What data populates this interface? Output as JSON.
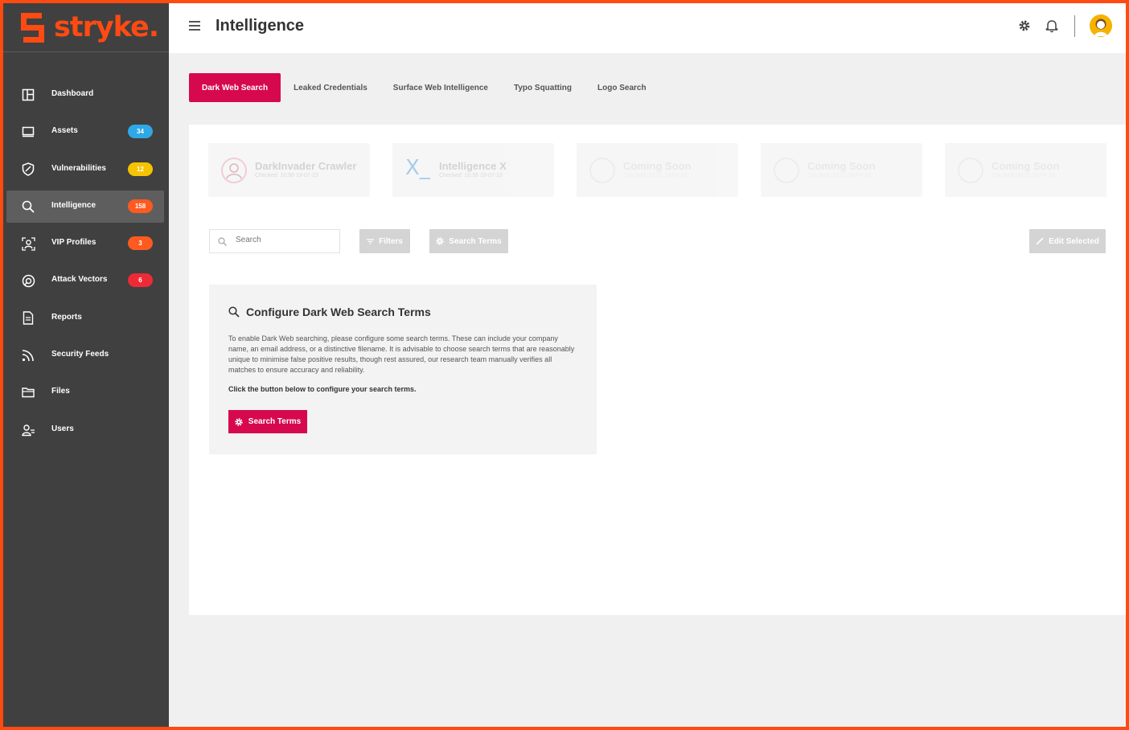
{
  "brand": {
    "name": "stryke.",
    "accent": "#ff4a12"
  },
  "header": {
    "title": "Intelligence",
    "icons": [
      "menu-icon",
      "gear-icon",
      "bell-icon",
      "avatar"
    ]
  },
  "sidebar": {
    "items": [
      {
        "label": "Dashboard",
        "icon": "dashboard-icon",
        "badge": ""
      },
      {
        "label": "Assets",
        "icon": "monitor-icon",
        "badge": "34",
        "badge_color": "#2ea8e6"
      },
      {
        "label": "Vulnerabilities",
        "icon": "shield-icon",
        "badge": "12",
        "badge_color": "#f5c400"
      },
      {
        "label": "Intelligence",
        "icon": "search-icon",
        "badge": "158",
        "badge_color": "#ff5a1f",
        "active": true
      },
      {
        "label": "VIP Profiles",
        "icon": "vip-icon",
        "badge": "3",
        "badge_color": "#ff5a1f"
      },
      {
        "label": "Attack Vectors",
        "icon": "attack-icon",
        "badge": "6",
        "badge_color": "#ee2a36"
      },
      {
        "label": "Reports",
        "icon": "document-icon",
        "badge": ""
      },
      {
        "label": "Security Feeds",
        "icon": "rss-icon",
        "badge": ""
      },
      {
        "label": "Files",
        "icon": "folder-icon",
        "badge": ""
      },
      {
        "label": "Users",
        "icon": "users-icon",
        "badge": ""
      }
    ]
  },
  "tabs": [
    {
      "label": "Dark Web Search",
      "active": true
    },
    {
      "label": "Leaked Credentials"
    },
    {
      "label": "Surface Web Intelligence"
    },
    {
      "label": "Typo Squatting"
    },
    {
      "label": "Logo Search"
    }
  ],
  "sources": [
    {
      "title": "DarkInvader Crawler",
      "sub": "Checked: 10:56 19-07-23"
    },
    {
      "title": "Intelligence X",
      "sub": "Checked: 10:56 19-07-23"
    },
    {
      "title": "Coming Soon",
      "sub": "Checked: 10:56 19-07-23"
    },
    {
      "title": "Coming Soon",
      "sub": "Checked: 10:56 19-07-23"
    },
    {
      "title": "Coming Soon",
      "sub": "Checked: 10:56 19-07-23"
    }
  ],
  "toolbar": {
    "search_placeholder": "Search",
    "filters_label": "Filters",
    "search_terms_label": "Search Terms",
    "edit_selected_label": "Edit Selected"
  },
  "config": {
    "title": "Configure Dark Web Search Terms",
    "body": "To enable Dark Web searching, please configure some search terms. These can include your company name, an email address, or a distinctive filename. It is advisable to choose search terms that are reasonably unique to minimise false positive results, though rest assured, our research team manually verifies all matches to ensure accuracy and reliability.",
    "cta": "Click the button below to configure your search terms.",
    "button_label": "Search Terms"
  }
}
